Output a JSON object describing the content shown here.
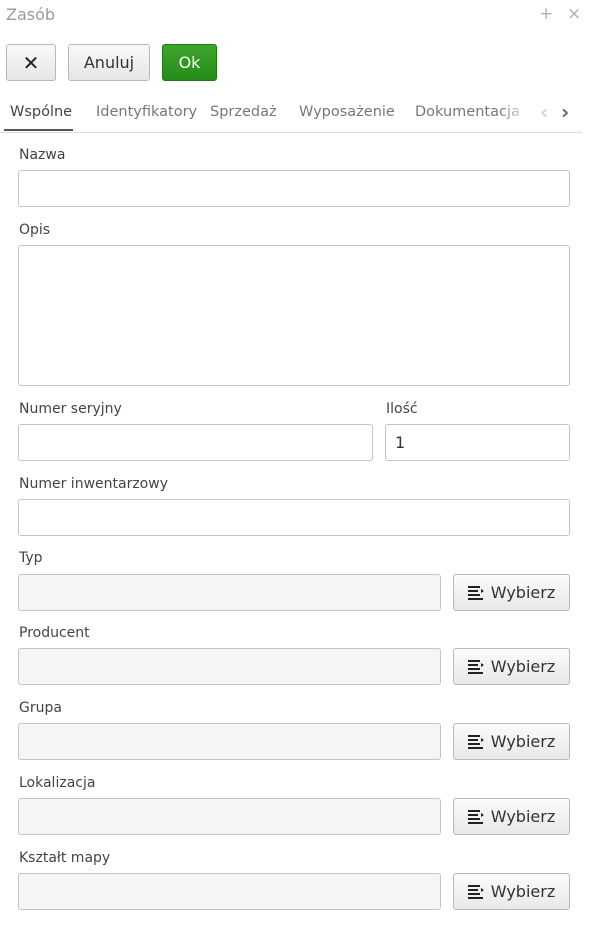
{
  "window": {
    "title": "Zasób",
    "plus_glyph": "+",
    "close_glyph": "×"
  },
  "toolbar": {
    "close_glyph": "✕",
    "cancel_label": "Anuluj",
    "ok_label": "Ok",
    "ok_color": "#2f9a22"
  },
  "tabs": [
    {
      "label": "Wspólne",
      "active": true
    },
    {
      "label": "Identyfikatory",
      "active": false
    },
    {
      "label": "Sprzedaż",
      "active": false
    },
    {
      "label": "Wyposażenie",
      "active": false
    },
    {
      "label": "Dokumentacja",
      "active": false
    }
  ],
  "tab_scroll": {
    "left_glyph": "‹",
    "right_glyph": "›"
  },
  "form": {
    "name": {
      "label": "Nazwa",
      "value": ""
    },
    "description": {
      "label": "Opis",
      "value": ""
    },
    "serial": {
      "label": "Numer seryjny",
      "value": ""
    },
    "quantity": {
      "label": "Ilość",
      "value": "1"
    },
    "inventory": {
      "label": "Numer inwentarzowy",
      "value": ""
    },
    "type": {
      "label": "Typ",
      "value": "",
      "button": "Wybierz"
    },
    "producer": {
      "label": "Producent",
      "value": "",
      "button": "Wybierz"
    },
    "group": {
      "label": "Grupa",
      "value": "",
      "button": "Wybierz"
    },
    "location": {
      "label": "Lokalizacja",
      "value": "",
      "button": "Wybierz"
    },
    "map_shape": {
      "label": "Kształt mapy",
      "value": "",
      "button": "Wybierz"
    }
  },
  "icons": {
    "pick": "list-select-icon"
  }
}
